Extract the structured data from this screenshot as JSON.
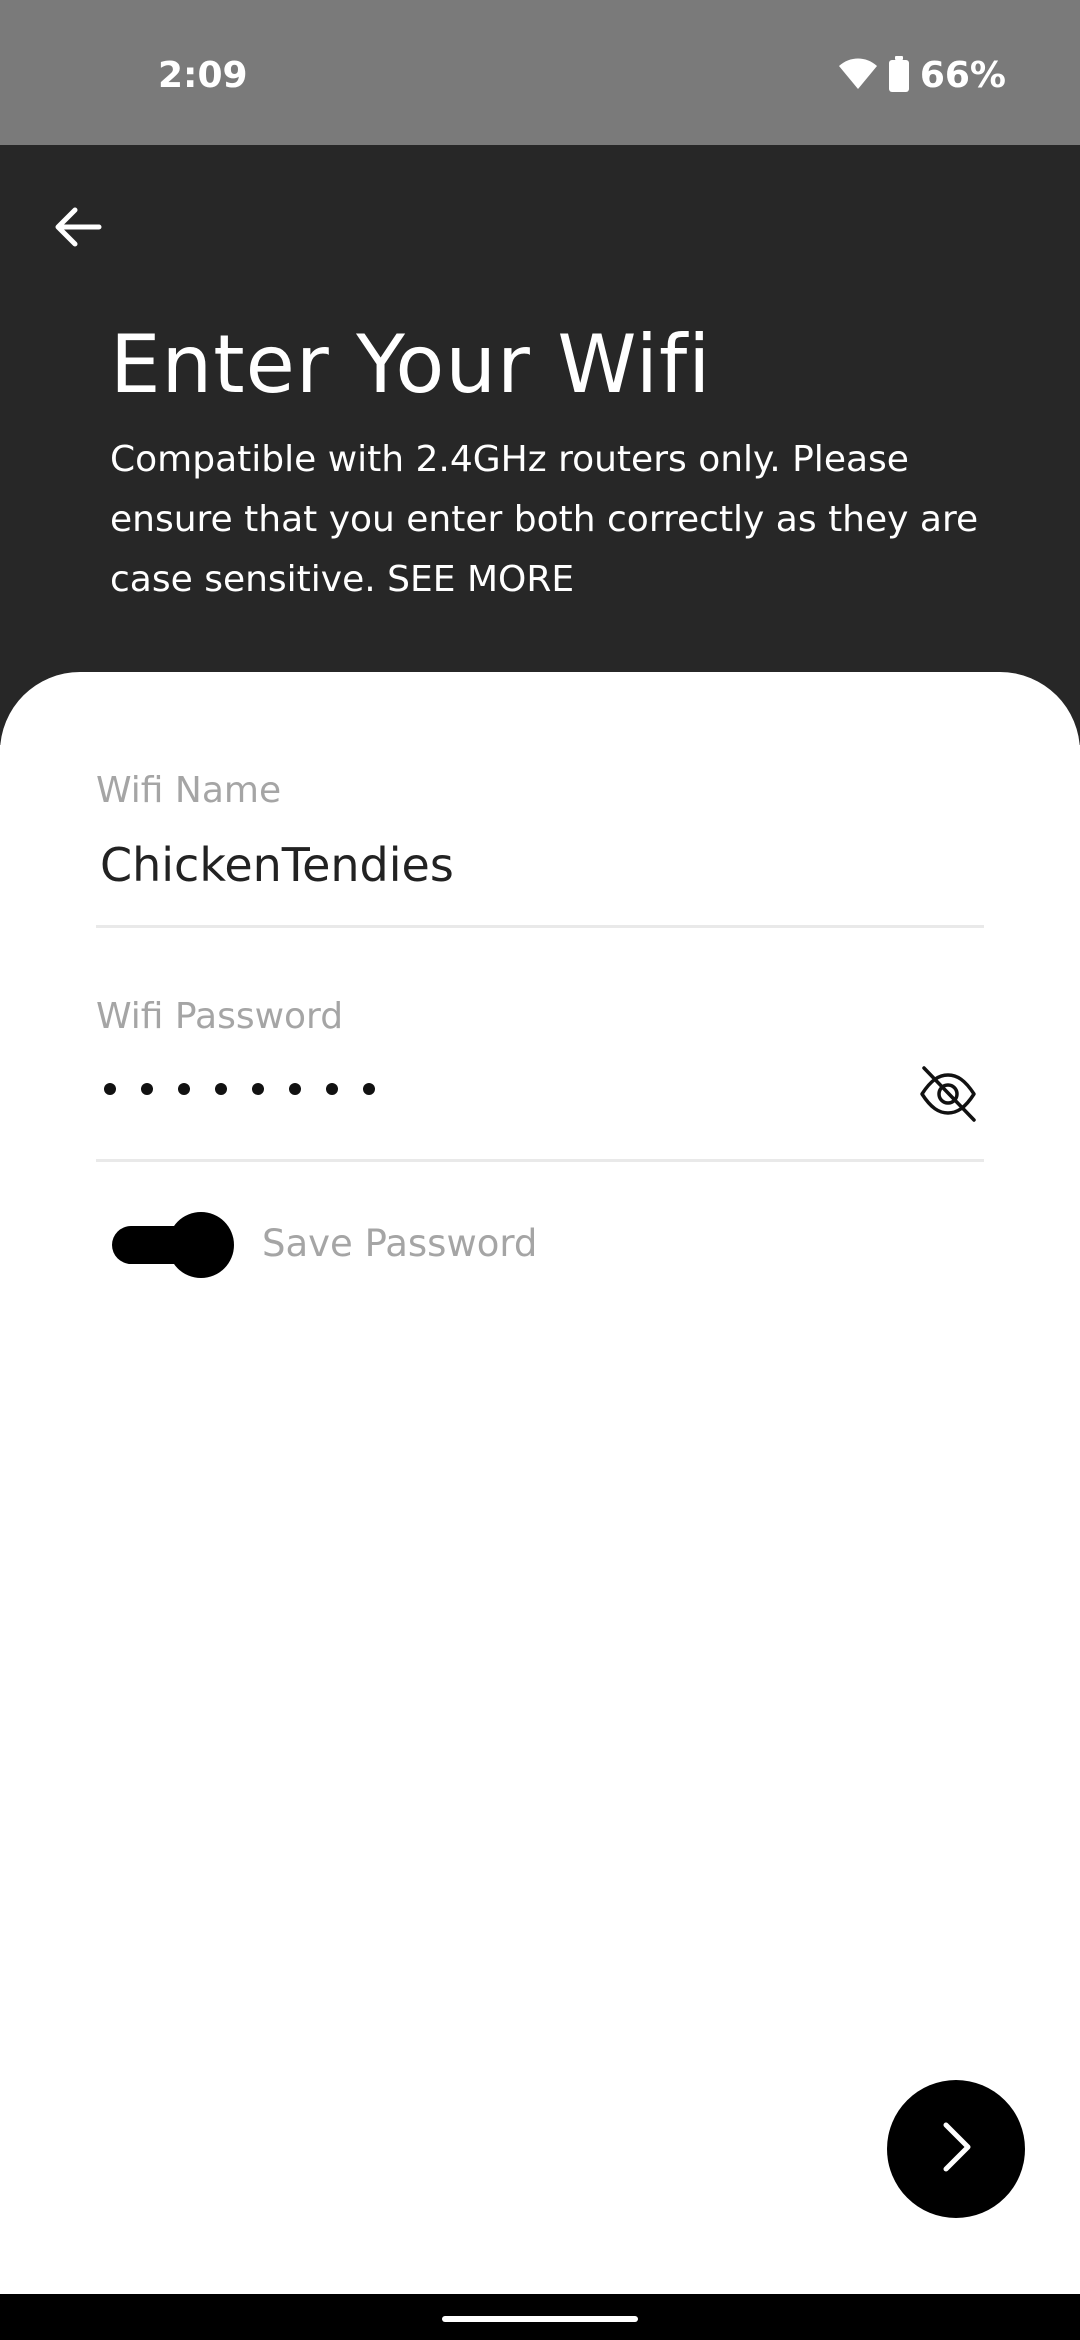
{
  "status_bar": {
    "time": "2:09",
    "battery_percent": "66%"
  },
  "header": {
    "title": "Enter Your Wifi",
    "subtitle": "Compatible with 2.4GHz routers only. Please ensure that you enter both correctly as they are case sensitive.",
    "see_more": "SEE MORE"
  },
  "form": {
    "wifi_name_label": "Wifi Name",
    "wifi_name_value": "ChickenTendies",
    "wifi_password_label": "Wifi Password",
    "wifi_password_masked_length": 8,
    "save_password_label": "Save Password",
    "save_password_enabled": true
  },
  "icons": {
    "back": "arrow-left-icon",
    "password_visibility": "eye-off-icon",
    "next": "chevron-right-icon",
    "wifi": "wifi-icon",
    "battery": "battery-icon"
  },
  "colors": {
    "status_bar": "#7a7a7a",
    "header": "#272727",
    "accent": "#000000",
    "label": "#a5a5a5"
  }
}
